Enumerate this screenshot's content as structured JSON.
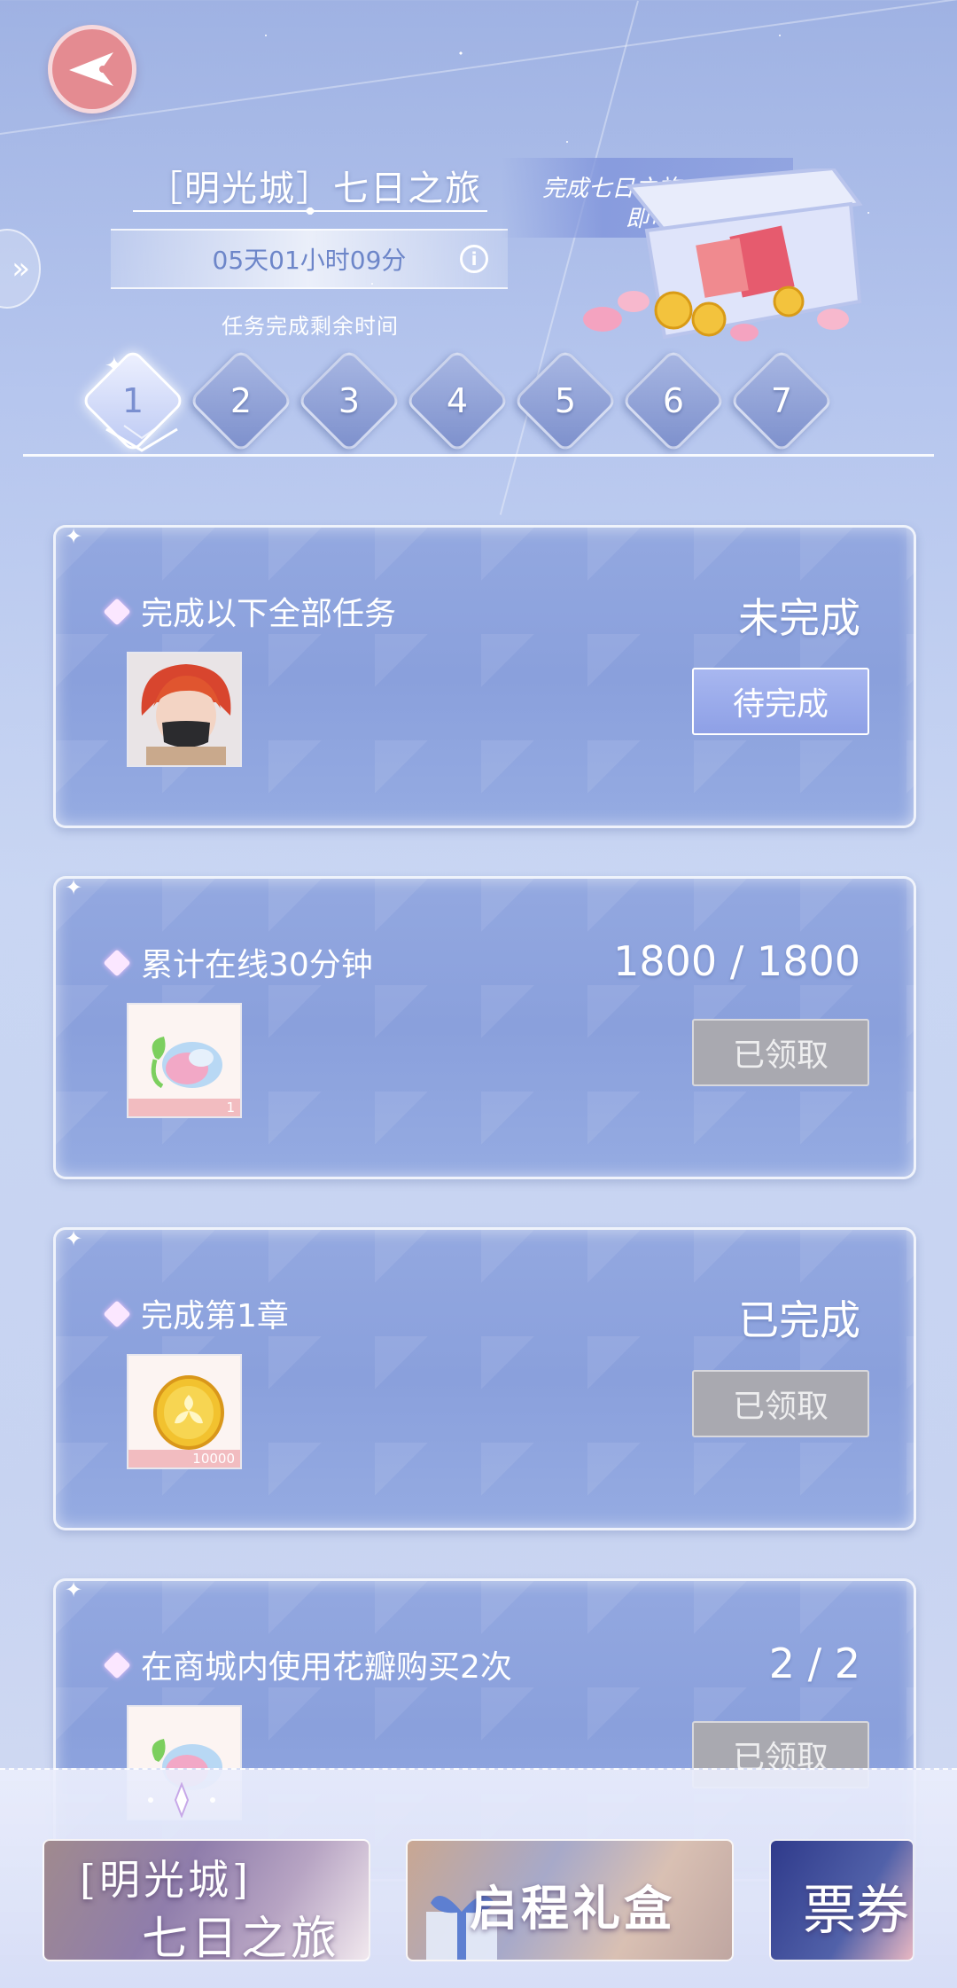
{
  "header": {
    "event_title": "［明光城］七日之旅",
    "countdown": "05天01小时09分",
    "countdown_caption": "任务完成剩余时间",
    "reward_line1": "完成七日之旅",
    "reward_line2": "即可得"
  },
  "day_tabs": [
    "1",
    "2",
    "3",
    "4",
    "5",
    "6",
    "7"
  ],
  "active_day": "1",
  "tasks": [
    {
      "title": "完成以下全部任务",
      "status": "未完成",
      "button": "待完成",
      "button_state": "pending",
      "item": "character-portrait",
      "item_count": ""
    },
    {
      "title": "累计在线30分钟",
      "status": "1800 / 1800",
      "button": "已领取",
      "button_state": "claimed",
      "item": "petal-bud",
      "item_count": "1"
    },
    {
      "title": "完成第1章",
      "status": "已完成",
      "button": "已领取",
      "button_state": "claimed",
      "item": "gold-coin",
      "item_count": "10000"
    },
    {
      "title": "在商城内使用花瓣购买2次",
      "status": "2 / 2",
      "button": "已领取",
      "button_state": "claimed",
      "item": "petal-bud",
      "item_count": ""
    }
  ],
  "bottom_banners": [
    {
      "line1": "[明光城]",
      "line2": "七日之旅"
    },
    {
      "line1": "启程礼盒"
    },
    {
      "line1": "票券"
    }
  ],
  "colors": {
    "accent": "#8ea0e6",
    "back_button": "#e48b91",
    "claimed_button": "#a9a9b0",
    "card_bg": "#8aa0dc"
  },
  "icons": {
    "back": "back-arrow-icon",
    "info": "info-icon",
    "side": "double-chevron-left-icon"
  }
}
